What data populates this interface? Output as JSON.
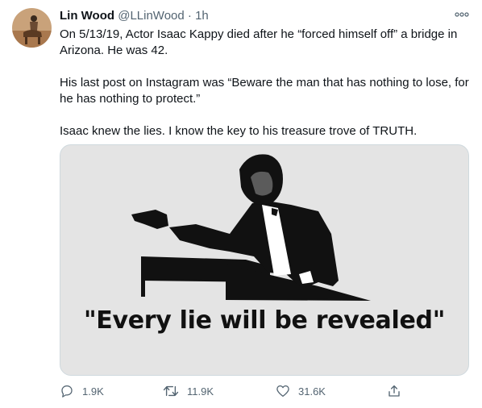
{
  "tweet": {
    "author_name": "Lin Wood",
    "author_handle": "@LLinWood",
    "separator": "·",
    "time": "1h",
    "paragraphs": [
      "On 5/13/19, Actor Isaac Kappy died after he “forced himself off” a bridge in Arizona. He was 42.",
      "His last post on Instagram was “Beware the man that has nothing to lose, for he has nothing to protect.”",
      "Isaac knew the lies. I know the key to his treasure trove of TRUTH."
    ],
    "image": {
      "caption": "\"Every lie will be revealed\"",
      "background": "#e4e4e4"
    }
  },
  "actions": {
    "replies": "1.9K",
    "retweets": "11.9K",
    "likes": "31.6K"
  },
  "icons": [
    "avatar",
    "more-icon",
    "reply-icon",
    "retweet-icon",
    "like-icon",
    "share-icon"
  ]
}
